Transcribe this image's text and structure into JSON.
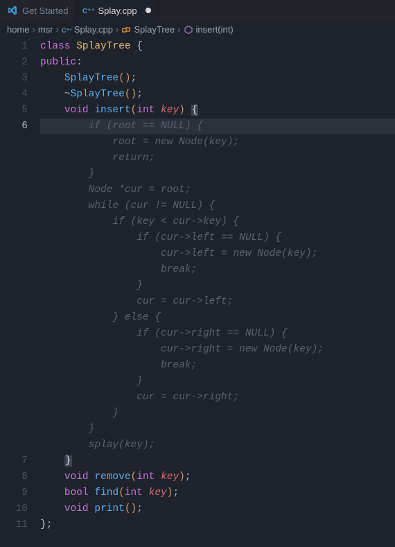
{
  "tabs": [
    {
      "label": "Get Started",
      "icon": "vscode",
      "active": false,
      "dirty": false
    },
    {
      "label": "Splay.cpp",
      "icon": "cpp",
      "active": true,
      "dirty": true
    }
  ],
  "breadcrumbs": [
    {
      "label": "home",
      "icon": null
    },
    {
      "label": "msr",
      "icon": null
    },
    {
      "label": "Splay.cpp",
      "icon": "cpp"
    },
    {
      "label": "SplayTree",
      "icon": "class"
    },
    {
      "label": "insert(int)",
      "icon": "method"
    }
  ],
  "gutter": {
    "lines": [
      "1",
      "2",
      "3",
      "4",
      "5",
      "6",
      "",
      "",
      "",
      "",
      "",
      "",
      "",
      "",
      "",
      "",
      "",
      "",
      "",
      "",
      "",
      "",
      "",
      "",
      "",
      "",
      "7",
      "8",
      "9",
      "10",
      "11"
    ],
    "active_index": 5
  },
  "code_tokens": [
    [
      [
        "kw",
        "class"
      ],
      [
        "sp",
        " "
      ],
      [
        "ident",
        "SplayTree"
      ],
      [
        "sp",
        " "
      ],
      [
        "brace",
        "{"
      ]
    ],
    [
      [
        "kw",
        "public"
      ],
      [
        "pun",
        ":"
      ]
    ],
    [
      [
        "sp",
        "    "
      ],
      [
        "fn",
        "SplayTree"
      ],
      [
        "paren",
        "()"
      ],
      [
        "pun",
        ";"
      ]
    ],
    [
      [
        "sp",
        "    "
      ],
      [
        "pun",
        "~"
      ],
      [
        "fn",
        "SplayTree"
      ],
      [
        "paren",
        "()"
      ],
      [
        "pun",
        ";"
      ]
    ],
    [
      [
        "sp",
        "    "
      ],
      [
        "type",
        "void"
      ],
      [
        "sp",
        " "
      ],
      [
        "fn",
        "insert"
      ],
      [
        "paren",
        "("
      ],
      [
        "type",
        "int"
      ],
      [
        "sp",
        " "
      ],
      [
        "param",
        "key"
      ],
      [
        "paren",
        ")"
      ],
      [
        "sp",
        " "
      ],
      [
        "sel",
        "{"
      ]
    ],
    [
      [
        "com",
        "        if (root == NULL) {"
      ]
    ],
    [
      [
        "com",
        "            root = new Node(key);"
      ]
    ],
    [
      [
        "com",
        "            return;"
      ]
    ],
    [
      [
        "com",
        "        }"
      ]
    ],
    [
      [
        "com",
        "        Node *cur = root;"
      ]
    ],
    [
      [
        "com",
        "        while (cur != NULL) {"
      ]
    ],
    [
      [
        "com",
        "            if (key < cur->key) {"
      ]
    ],
    [
      [
        "com",
        "                if (cur->left == NULL) {"
      ]
    ],
    [
      [
        "com",
        "                    cur->left = new Node(key);"
      ]
    ],
    [
      [
        "com",
        "                    break;"
      ]
    ],
    [
      [
        "com",
        "                }"
      ]
    ],
    [
      [
        "com",
        "                cur = cur->left;"
      ]
    ],
    [
      [
        "com",
        "            } else {"
      ]
    ],
    [
      [
        "com",
        "                if (cur->right == NULL) {"
      ]
    ],
    [
      [
        "com",
        "                    cur->right = new Node(key);"
      ]
    ],
    [
      [
        "com",
        "                    break;"
      ]
    ],
    [
      [
        "com",
        "                }"
      ]
    ],
    [
      [
        "com",
        "                cur = cur->right;"
      ]
    ],
    [
      [
        "com",
        "            }"
      ]
    ],
    [
      [
        "com",
        "        }"
      ]
    ],
    [
      [
        "com",
        "        splay(key);"
      ]
    ],
    [
      [
        "sp",
        "    "
      ],
      [
        "sel",
        "}"
      ]
    ],
    [
      [
        "sp",
        "    "
      ],
      [
        "type",
        "void"
      ],
      [
        "sp",
        " "
      ],
      [
        "fn",
        "remove"
      ],
      [
        "paren",
        "("
      ],
      [
        "type",
        "int"
      ],
      [
        "sp",
        " "
      ],
      [
        "param",
        "key"
      ],
      [
        "paren",
        ")"
      ],
      [
        "pun",
        ";"
      ]
    ],
    [
      [
        "sp",
        "    "
      ],
      [
        "type",
        "bool"
      ],
      [
        "sp",
        " "
      ],
      [
        "fn",
        "find"
      ],
      [
        "paren",
        "("
      ],
      [
        "type",
        "int"
      ],
      [
        "sp",
        " "
      ],
      [
        "param",
        "key"
      ],
      [
        "paren",
        ")"
      ],
      [
        "pun",
        ";"
      ]
    ],
    [
      [
        "sp",
        "    "
      ],
      [
        "type",
        "void"
      ],
      [
        "sp",
        " "
      ],
      [
        "fn",
        "print"
      ],
      [
        "paren",
        "()"
      ],
      [
        "pun",
        ";"
      ]
    ],
    [
      [
        "brace",
        "}"
      ],
      [
        "pun",
        ";"
      ]
    ]
  ],
  "highlight_line_index": 5,
  "colors": {
    "bg": "#1e222a",
    "kw": "#c678dd",
    "ident": "#e5c07b",
    "fn": "#61afef",
    "paren": "#d19a66",
    "param": "#e06c75",
    "com": "#5c6370"
  }
}
